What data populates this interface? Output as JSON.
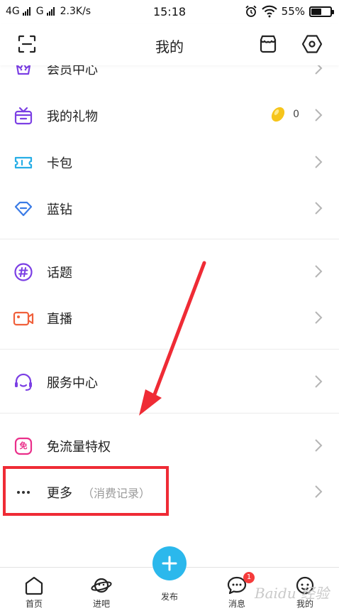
{
  "status_bar": {
    "network1": "4G",
    "network2": "G",
    "speed": "2.3K/s",
    "time": "15:18",
    "battery_text": "55%",
    "battery_level": 0.55
  },
  "header": {
    "title": "我的"
  },
  "menu": {
    "membership": "会员中心",
    "gifts": "我的礼物",
    "gifts_count": "0",
    "card_pack": "卡包",
    "blue_diamond": "蓝钻",
    "topics": "话题",
    "live": "直播",
    "service_center": "服务中心",
    "free_traffic": "免流量特权",
    "free_traffic_icon_text": "免",
    "more": "更多",
    "more_sub": "（消费记录）"
  },
  "bottom_nav": {
    "home": "首页",
    "bars": "进吧",
    "publish": "发布",
    "messages": "消息",
    "messages_badge": "1",
    "mine": "我的",
    "watermark": "Baidu 经验"
  },
  "colors": {
    "purple": "#7b3fe4",
    "teal": "#27aee6",
    "blue": "#3a7be6",
    "orange": "#f0603b",
    "pink": "#ea2f8a",
    "annotation_red": "#ef2b35",
    "publish_blue": "#2bb8ec"
  },
  "icons": {
    "scan": "scan-icon",
    "store": "store-icon",
    "settings": "settings-hexagon-icon",
    "gift": "gift-icon",
    "card": "ticket-icon",
    "diamond": "diamond-icon",
    "topic": "hashtag-icon",
    "live": "video-camera-icon",
    "service": "headset-icon",
    "free": "free-badge-icon",
    "more": "ellipsis-icon",
    "chevron": "chevron-right-icon",
    "bean": "bean-coin-icon"
  }
}
